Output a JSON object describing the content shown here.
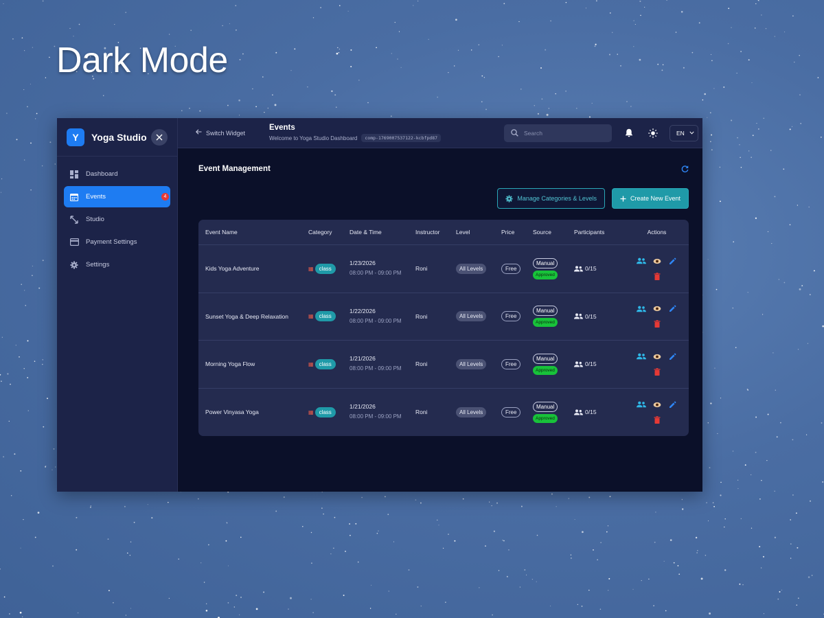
{
  "hero": {
    "title": "Dark Mode"
  },
  "sidebar": {
    "logo_letter": "Y",
    "brand": "Yoga Studio",
    "items": [
      {
        "label": "Dashboard",
        "icon": "dashboard-icon"
      },
      {
        "label": "Events",
        "icon": "calendar-icon",
        "badge": "4"
      },
      {
        "label": "Studio",
        "icon": "resize-icon"
      },
      {
        "label": "Payment Settings",
        "icon": "credit-card-icon"
      },
      {
        "label": "Settings",
        "icon": "gear-icon"
      }
    ]
  },
  "topbar": {
    "switch_label": "Switch Widget",
    "title": "Events",
    "subtitle": "Welcome to Yoga Studio Dashboard",
    "component_id": "comp-1769007537122-kcbfpd87",
    "search_placeholder": "Search",
    "language": "EN"
  },
  "content": {
    "section_title": "Event Management",
    "manage_button": "Manage Categories & Levels",
    "create_button": "Create New Event"
  },
  "table": {
    "headers": [
      "Event Name",
      "Category",
      "Date & Time",
      "Instructor",
      "Level",
      "Price",
      "Source",
      "Participants",
      "Actions"
    ],
    "rows": [
      {
        "name": "Kids Yoga Adventure",
        "category": "class",
        "date": "1/23/2026",
        "time": "08:00 PM - 09:00 PM",
        "instructor": "Roni",
        "level": "All Levels",
        "price": "Free",
        "source": "Manual",
        "status": "Approved",
        "participants": "0/15"
      },
      {
        "name": "Sunset Yoga & Deep Relaxation",
        "category": "class",
        "date": "1/22/2026",
        "time": "08:00 PM - 09:00 PM",
        "instructor": "Roni",
        "level": "All Levels",
        "price": "Free",
        "source": "Manual",
        "status": "Approved",
        "participants": "0/15"
      },
      {
        "name": "Morning Yoga Flow",
        "category": "class",
        "date": "1/21/2026",
        "time": "08:00 PM - 09:00 PM",
        "instructor": "Roni",
        "level": "All Levels",
        "price": "Free",
        "source": "Manual",
        "status": "Approved",
        "participants": "0/15"
      },
      {
        "name": "Power Vinyasa Yoga",
        "category": "class",
        "date": "1/21/2026",
        "time": "08:00 PM - 09:00 PM",
        "instructor": "Roni",
        "level": "All Levels",
        "price": "Free",
        "source": "Manual",
        "status": "Approved",
        "participants": "0/15"
      }
    ]
  },
  "colors": {
    "accent": "#1e7cf2",
    "teal": "#1f9aa8",
    "approved": "#18c23a",
    "delete": "#e53935",
    "background": "#0b1029",
    "panel": "#1c2348"
  }
}
